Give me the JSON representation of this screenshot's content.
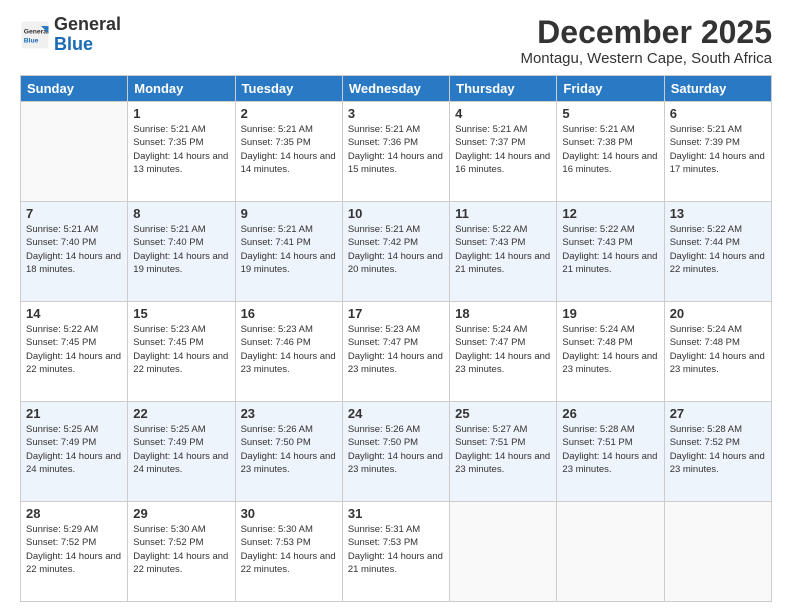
{
  "logo": {
    "text_general": "General",
    "text_blue": "Blue"
  },
  "header": {
    "month_title": "December 2025",
    "subtitle": "Montagu, Western Cape, South Africa"
  },
  "weekdays": [
    "Sunday",
    "Monday",
    "Tuesday",
    "Wednesday",
    "Thursday",
    "Friday",
    "Saturday"
  ],
  "weeks": [
    [
      {
        "day": "",
        "sunrise": "",
        "sunset": "",
        "daylight": ""
      },
      {
        "day": "1",
        "sunrise": "Sunrise: 5:21 AM",
        "sunset": "Sunset: 7:35 PM",
        "daylight": "Daylight: 14 hours and 13 minutes."
      },
      {
        "day": "2",
        "sunrise": "Sunrise: 5:21 AM",
        "sunset": "Sunset: 7:35 PM",
        "daylight": "Daylight: 14 hours and 14 minutes."
      },
      {
        "day": "3",
        "sunrise": "Sunrise: 5:21 AM",
        "sunset": "Sunset: 7:36 PM",
        "daylight": "Daylight: 14 hours and 15 minutes."
      },
      {
        "day": "4",
        "sunrise": "Sunrise: 5:21 AM",
        "sunset": "Sunset: 7:37 PM",
        "daylight": "Daylight: 14 hours and 16 minutes."
      },
      {
        "day": "5",
        "sunrise": "Sunrise: 5:21 AM",
        "sunset": "Sunset: 7:38 PM",
        "daylight": "Daylight: 14 hours and 16 minutes."
      },
      {
        "day": "6",
        "sunrise": "Sunrise: 5:21 AM",
        "sunset": "Sunset: 7:39 PM",
        "daylight": "Daylight: 14 hours and 17 minutes."
      }
    ],
    [
      {
        "day": "7",
        "sunrise": "Sunrise: 5:21 AM",
        "sunset": "Sunset: 7:40 PM",
        "daylight": "Daylight: 14 hours and 18 minutes."
      },
      {
        "day": "8",
        "sunrise": "Sunrise: 5:21 AM",
        "sunset": "Sunset: 7:40 PM",
        "daylight": "Daylight: 14 hours and 19 minutes."
      },
      {
        "day": "9",
        "sunrise": "Sunrise: 5:21 AM",
        "sunset": "Sunset: 7:41 PM",
        "daylight": "Daylight: 14 hours and 19 minutes."
      },
      {
        "day": "10",
        "sunrise": "Sunrise: 5:21 AM",
        "sunset": "Sunset: 7:42 PM",
        "daylight": "Daylight: 14 hours and 20 minutes."
      },
      {
        "day": "11",
        "sunrise": "Sunrise: 5:22 AM",
        "sunset": "Sunset: 7:43 PM",
        "daylight": "Daylight: 14 hours and 21 minutes."
      },
      {
        "day": "12",
        "sunrise": "Sunrise: 5:22 AM",
        "sunset": "Sunset: 7:43 PM",
        "daylight": "Daylight: 14 hours and 21 minutes."
      },
      {
        "day": "13",
        "sunrise": "Sunrise: 5:22 AM",
        "sunset": "Sunset: 7:44 PM",
        "daylight": "Daylight: 14 hours and 22 minutes."
      }
    ],
    [
      {
        "day": "14",
        "sunrise": "Sunrise: 5:22 AM",
        "sunset": "Sunset: 7:45 PM",
        "daylight": "Daylight: 14 hours and 22 minutes."
      },
      {
        "day": "15",
        "sunrise": "Sunrise: 5:23 AM",
        "sunset": "Sunset: 7:45 PM",
        "daylight": "Daylight: 14 hours and 22 minutes."
      },
      {
        "day": "16",
        "sunrise": "Sunrise: 5:23 AM",
        "sunset": "Sunset: 7:46 PM",
        "daylight": "Daylight: 14 hours and 23 minutes."
      },
      {
        "day": "17",
        "sunrise": "Sunrise: 5:23 AM",
        "sunset": "Sunset: 7:47 PM",
        "daylight": "Daylight: 14 hours and 23 minutes."
      },
      {
        "day": "18",
        "sunrise": "Sunrise: 5:24 AM",
        "sunset": "Sunset: 7:47 PM",
        "daylight": "Daylight: 14 hours and 23 minutes."
      },
      {
        "day": "19",
        "sunrise": "Sunrise: 5:24 AM",
        "sunset": "Sunset: 7:48 PM",
        "daylight": "Daylight: 14 hours and 23 minutes."
      },
      {
        "day": "20",
        "sunrise": "Sunrise: 5:24 AM",
        "sunset": "Sunset: 7:48 PM",
        "daylight": "Daylight: 14 hours and 23 minutes."
      }
    ],
    [
      {
        "day": "21",
        "sunrise": "Sunrise: 5:25 AM",
        "sunset": "Sunset: 7:49 PM",
        "daylight": "Daylight: 14 hours and 24 minutes."
      },
      {
        "day": "22",
        "sunrise": "Sunrise: 5:25 AM",
        "sunset": "Sunset: 7:49 PM",
        "daylight": "Daylight: 14 hours and 24 minutes."
      },
      {
        "day": "23",
        "sunrise": "Sunrise: 5:26 AM",
        "sunset": "Sunset: 7:50 PM",
        "daylight": "Daylight: 14 hours and 23 minutes."
      },
      {
        "day": "24",
        "sunrise": "Sunrise: 5:26 AM",
        "sunset": "Sunset: 7:50 PM",
        "daylight": "Daylight: 14 hours and 23 minutes."
      },
      {
        "day": "25",
        "sunrise": "Sunrise: 5:27 AM",
        "sunset": "Sunset: 7:51 PM",
        "daylight": "Daylight: 14 hours and 23 minutes."
      },
      {
        "day": "26",
        "sunrise": "Sunrise: 5:28 AM",
        "sunset": "Sunset: 7:51 PM",
        "daylight": "Daylight: 14 hours and 23 minutes."
      },
      {
        "day": "27",
        "sunrise": "Sunrise: 5:28 AM",
        "sunset": "Sunset: 7:52 PM",
        "daylight": "Daylight: 14 hours and 23 minutes."
      }
    ],
    [
      {
        "day": "28",
        "sunrise": "Sunrise: 5:29 AM",
        "sunset": "Sunset: 7:52 PM",
        "daylight": "Daylight: 14 hours and 22 minutes."
      },
      {
        "day": "29",
        "sunrise": "Sunrise: 5:30 AM",
        "sunset": "Sunset: 7:52 PM",
        "daylight": "Daylight: 14 hours and 22 minutes."
      },
      {
        "day": "30",
        "sunrise": "Sunrise: 5:30 AM",
        "sunset": "Sunset: 7:53 PM",
        "daylight": "Daylight: 14 hours and 22 minutes."
      },
      {
        "day": "31",
        "sunrise": "Sunrise: 5:31 AM",
        "sunset": "Sunset: 7:53 PM",
        "daylight": "Daylight: 14 hours and 21 minutes."
      },
      {
        "day": "",
        "sunrise": "",
        "sunset": "",
        "daylight": ""
      },
      {
        "day": "",
        "sunrise": "",
        "sunset": "",
        "daylight": ""
      },
      {
        "day": "",
        "sunrise": "",
        "sunset": "",
        "daylight": ""
      }
    ]
  ]
}
